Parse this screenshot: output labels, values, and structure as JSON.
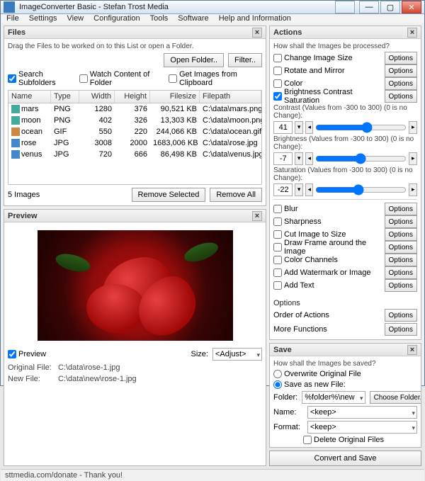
{
  "title": "ImageConverter Basic - Stefan Trost Media",
  "menu": [
    "File",
    "Settings",
    "View",
    "Configuration",
    "Tools",
    "Software",
    "Help and Information"
  ],
  "files": {
    "title": "Files",
    "hint": "Drag the Files to be worked on to this List or open a Folder.",
    "open_folder": "Open Folder..",
    "filter": "Filter..",
    "search_sub": "Search Subfolders",
    "watch": "Watch Content of Folder",
    "clipboard": "Get Images from Clipboard",
    "cols": {
      "name": "Name",
      "type": "Type",
      "width": "Width",
      "height": "Height",
      "size": "Filesize",
      "path": "Filepath"
    },
    "rows": [
      {
        "icon": "png",
        "name": "mars",
        "type": "PNG",
        "w": "1280",
        "h": "376",
        "sz": "90,521 KB",
        "fp": "C:\\data\\mars.png"
      },
      {
        "icon": "png",
        "name": "moon",
        "type": "PNG",
        "w": "402",
        "h": "326",
        "sz": "13,303 KB",
        "fp": "C:\\data\\moon.png"
      },
      {
        "icon": "gif",
        "name": "ocean",
        "type": "GIF",
        "w": "550",
        "h": "220",
        "sz": "244,066 KB",
        "fp": "C:\\data\\ocean.gif"
      },
      {
        "icon": "jpg",
        "name": "rose",
        "type": "JPG",
        "w": "3008",
        "h": "2000",
        "sz": "1683,006 KB",
        "fp": "C:\\data\\rose.jpg"
      },
      {
        "icon": "jpg",
        "name": "venus",
        "type": "JPG",
        "w": "720",
        "h": "666",
        "sz": "86,498 KB",
        "fp": "C:\\data\\venus.jpg"
      }
    ],
    "count": "5 Images",
    "remove_sel": "Remove Selected",
    "remove_all": "Remove All"
  },
  "preview": {
    "title": "Preview",
    "cb": "Preview",
    "size_lbl": "Size:",
    "size_val": "<Adjust>",
    "orig_lbl": "Original File:",
    "orig_val": "C:\\data\\rose-1.jpg",
    "new_lbl": "New File:",
    "new_val": "C:\\data\\new\\rose-1.jpg"
  },
  "actions": {
    "title": "Actions",
    "q": "How shall the Images be processed?",
    "opt": "Options",
    "items": [
      "Change Image Size",
      "Rotate and Mirror",
      "Color",
      "Brightness Contrast Saturation"
    ],
    "contrast_lbl": "Contrast (Values from -300 to 300) (0 is no Change):",
    "contrast": "41",
    "bright_lbl": "Brightness (Values from -300 to 300) (0 is no Change):",
    "bright": "-7",
    "sat_lbl": "Saturation (Values from -300 to 300) (0 is no Change):",
    "sat": "-22",
    "items2": [
      "Blur",
      "Sharpness",
      "Cut Image to Size",
      "Draw Frame around the Image",
      "Color Channels",
      "Add Watermark or Image",
      "Add Text"
    ],
    "opts_hdr": "Options",
    "order": "Order of Actions",
    "more": "More Functions"
  },
  "save": {
    "title": "Save",
    "q": "How shall the Images be saved?",
    "overwrite": "Overwrite Original File",
    "saveas": "Save as new File:",
    "folder_lbl": "Folder:",
    "folder_val": "%folder%\\new",
    "choose": "Choose Folder..",
    "name_lbl": "Name:",
    "name_val": "<keep>",
    "format_lbl": "Format:",
    "format_val": "<keep>",
    "delete": "Delete Original Files",
    "go": "Convert and Save"
  },
  "status": "sttmedia.com/donate - Thank you!"
}
